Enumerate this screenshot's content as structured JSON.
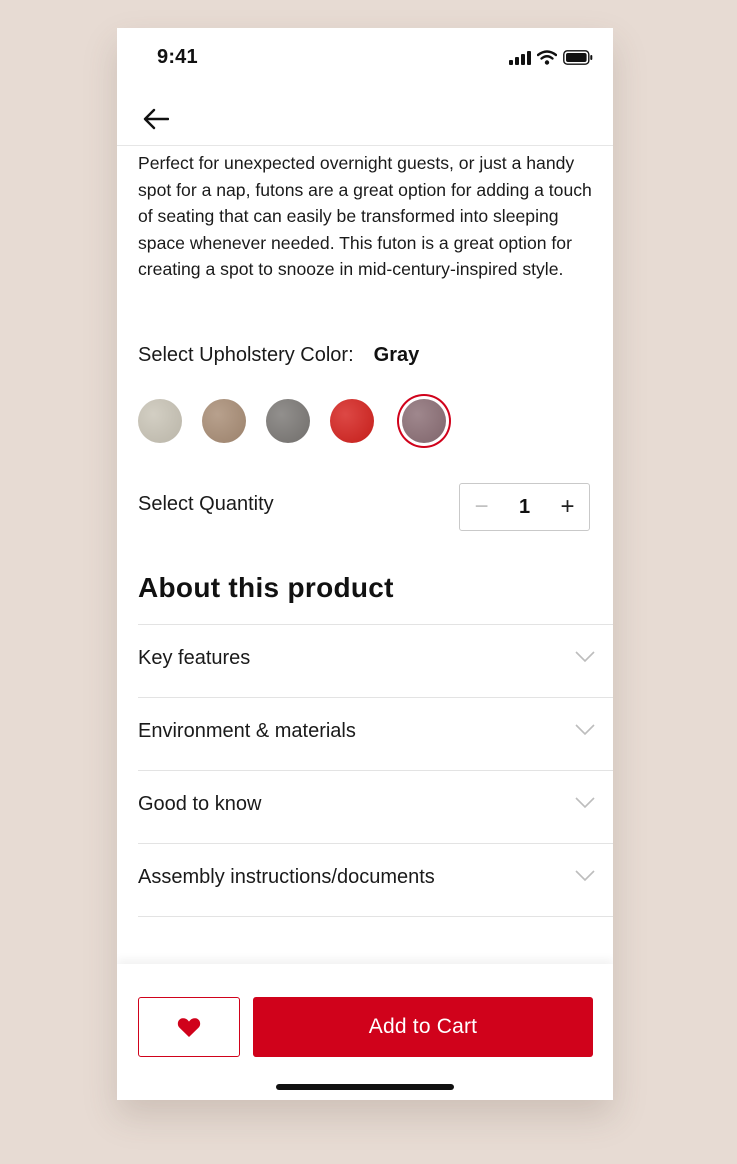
{
  "status_bar": {
    "time": "9:41"
  },
  "product": {
    "description": "Perfect for unexpected overnight guests, or just a handy spot for a nap, futons are a great option for adding a touch of seating that can easily be transformed into sleeping space whenever needed. This futon is a great option for creating a spot to snooze in mid-century-inspired style.",
    "color_label": "Select Upholstery Color:",
    "selected_color": "Gray",
    "swatches": [
      {
        "name": "beige",
        "color": "#c9c4b6"
      },
      {
        "name": "tan",
        "color": "#a88c74"
      },
      {
        "name": "gray",
        "color": "#7a7774"
      },
      {
        "name": "red",
        "color": "#d5201c"
      },
      {
        "name": "mauve",
        "color": "#8a6d74",
        "selected": true
      }
    ],
    "quantity_label": "Select Quantity",
    "quantity": "1",
    "minus_symbol": "−",
    "plus_symbol": "+"
  },
  "about": {
    "title": "About this product",
    "sections": [
      {
        "label": "Key features"
      },
      {
        "label": "Environment & materials"
      },
      {
        "label": "Good to know"
      },
      {
        "label": "Assembly instructions/documents"
      }
    ]
  },
  "actions": {
    "add_to_cart": "Add to Cart",
    "wishlist_icon": "heart-icon"
  },
  "colors": {
    "accent": "#d0021b",
    "background": "#e7dbd3"
  }
}
